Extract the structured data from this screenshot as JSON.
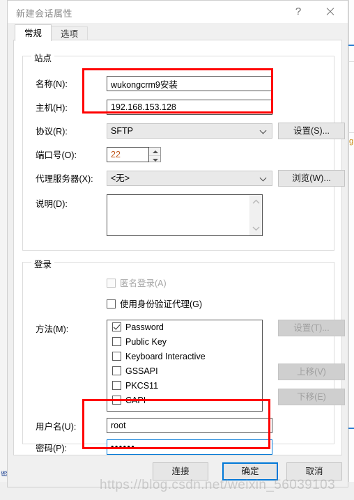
{
  "window": {
    "title": "新建会话属性",
    "help_label": "?",
    "close_label": "✕"
  },
  "tabs": [
    {
      "label": "常规",
      "active": true
    },
    {
      "label": "选项",
      "active": false
    }
  ],
  "site": {
    "group_title": "站点",
    "name_label": "名称(N):",
    "name_value": "wukongcrm9安装",
    "host_label": "主机(H):",
    "host_value": "192.168.153.128",
    "protocol_label": "协议(R):",
    "protocol_value": "SFTP",
    "protocol_settings_button": "设置(S)...",
    "port_label": "端口号(O):",
    "port_value": "22",
    "proxy_label": "代理服务器(X):",
    "proxy_value": "<无>",
    "proxy_browse_button": "浏览(W)...",
    "description_label": "说明(D):",
    "description_value": ""
  },
  "login": {
    "group_title": "登录",
    "anonymous_label": "匿名登录(A)",
    "anonymous_checked": false,
    "anonymous_disabled": true,
    "agent_label": "使用身份验证代理(G)",
    "agent_checked": false,
    "method_label": "方法(M):",
    "methods": [
      {
        "label": "Password",
        "checked": true
      },
      {
        "label": "Public Key",
        "checked": false
      },
      {
        "label": "Keyboard Interactive",
        "checked": false
      },
      {
        "label": "GSSAPI",
        "checked": false
      },
      {
        "label": "PKCS11",
        "checked": false
      },
      {
        "label": "CAPI",
        "checked": false
      }
    ],
    "method_settings_button": "设置(T)...",
    "move_up_button": "上移(V)",
    "move_down_button": "下移(E)",
    "username_label": "用户名(U):",
    "username_value": "root",
    "password_label": "密码(P):",
    "password_value": "••••••"
  },
  "footer": {
    "connect_button": "连接",
    "ok_button": "确定",
    "cancel_button": "取消"
  },
  "annotation": {
    "color": "#ff0000",
    "boxes": 2
  },
  "watermark": {
    "text": "https://blog.csdn.net/weixin_56039103"
  },
  "background": {
    "right_glyph": "g",
    "bottom_left_glyph": "密"
  }
}
